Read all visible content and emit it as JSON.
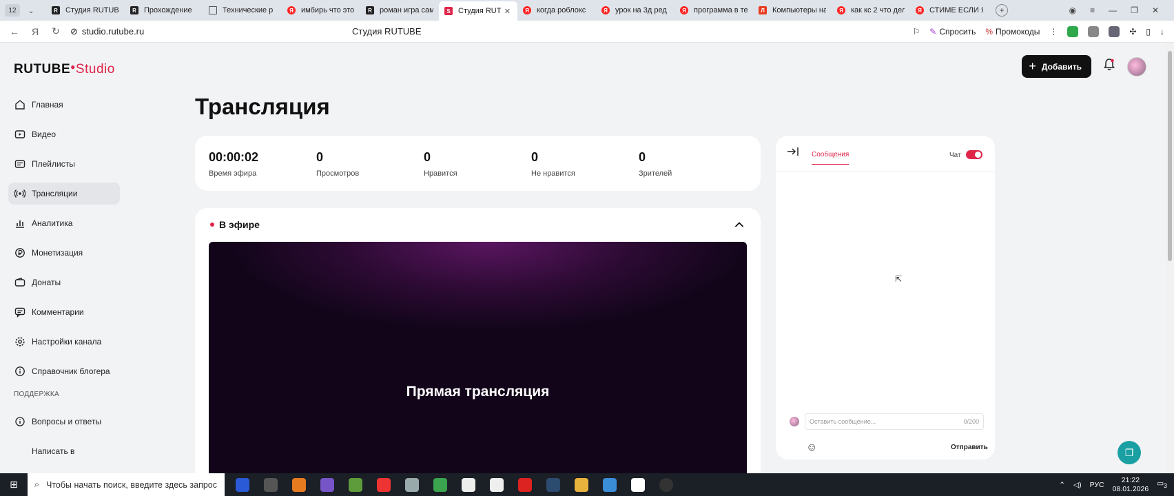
{
  "browser": {
    "tab_count": "12",
    "tabs": [
      {
        "label": "Студия RUTUBE",
        "icon": "rt"
      },
      {
        "label": "Прохождение",
        "icon": "rt"
      },
      {
        "label": "Технические р",
        "icon": "doc"
      },
      {
        "label": "имбирь что это",
        "icon": "ya"
      },
      {
        "label": "роман игра сам",
        "icon": "rt"
      },
      {
        "label": "Студия RUT",
        "icon": "studio"
      },
      {
        "label": "когда роблокс",
        "icon": "ya"
      },
      {
        "label": "урок на 3д ред",
        "icon": "ya"
      },
      {
        "label": "программа в те",
        "icon": "ya"
      },
      {
        "label": "Компьютеры на",
        "icon": "mag"
      },
      {
        "label": "как кс 2 что дел",
        "icon": "ya"
      },
      {
        "label": "СТИМЕ ЕСЛИ Я",
        "icon": "ya"
      }
    ],
    "url": "studio.rutube.ru",
    "page_title": "Студия RUTUBE",
    "ask_label": "Спросить",
    "promo_label": "Промокоды"
  },
  "app": {
    "logo_main": "RUTUBE",
    "logo_sub": "Studio",
    "add_button": "Добавить",
    "sidebar": {
      "items": [
        {
          "label": "Главная",
          "icon": "home-icon"
        },
        {
          "label": "Видео",
          "icon": "video-icon"
        },
        {
          "label": "Плейлисты",
          "icon": "playlist-icon"
        },
        {
          "label": "Трансляции",
          "icon": "broadcast-icon"
        },
        {
          "label": "Аналитика",
          "icon": "analytics-icon"
        },
        {
          "label": "Монетизация",
          "icon": "money-icon"
        },
        {
          "label": "Донаты",
          "icon": "wallet-icon"
        },
        {
          "label": "Комментарии",
          "icon": "comment-icon"
        },
        {
          "label": "Настройки канала",
          "icon": "gear-icon"
        },
        {
          "label": "Справочник блогера",
          "icon": "info-icon"
        }
      ],
      "support_title": "ПОДДЕРЖКА",
      "support_items": [
        {
          "label": "Вопросы и ответы"
        },
        {
          "label": "Написать в"
        }
      ]
    },
    "page_heading": "Трансляция",
    "stats": [
      {
        "value": "00:00:02",
        "label": "Время эфира"
      },
      {
        "value": "0",
        "label": "Просмотров"
      },
      {
        "value": "0",
        "label": "Нравится"
      },
      {
        "value": "0",
        "label": "Не нравится"
      },
      {
        "value": "0",
        "label": "Зрителей"
      }
    ],
    "live": {
      "title": "В эфире",
      "player_text": "Прямая трансляция"
    },
    "chat": {
      "tab_messages": "Сообщения",
      "toggle_label": "Чат",
      "input_placeholder": "Оставить сообщение...",
      "counter": "0/200",
      "send_label": "Отправить"
    }
  },
  "taskbar": {
    "search_placeholder": "Чтобы начать поиск, введите здесь запрос",
    "lang": "РУС",
    "time": "21:22",
    "date": "08.01.2026",
    "notif_count": "3"
  }
}
